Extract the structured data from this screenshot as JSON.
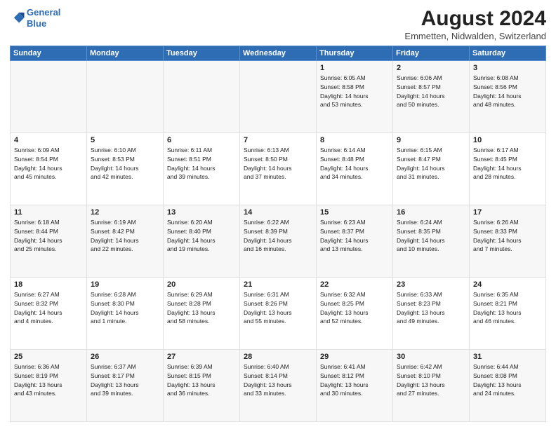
{
  "header": {
    "logo_line1": "General",
    "logo_line2": "Blue",
    "title": "August 2024",
    "subtitle": "Emmetten, Nidwalden, Switzerland"
  },
  "weekdays": [
    "Sunday",
    "Monday",
    "Tuesday",
    "Wednesday",
    "Thursday",
    "Friday",
    "Saturday"
  ],
  "weeks": [
    [
      {
        "day": "",
        "info": ""
      },
      {
        "day": "",
        "info": ""
      },
      {
        "day": "",
        "info": ""
      },
      {
        "day": "",
        "info": ""
      },
      {
        "day": "1",
        "info": "Sunrise: 6:05 AM\nSunset: 8:58 PM\nDaylight: 14 hours\nand 53 minutes."
      },
      {
        "day": "2",
        "info": "Sunrise: 6:06 AM\nSunset: 8:57 PM\nDaylight: 14 hours\nand 50 minutes."
      },
      {
        "day": "3",
        "info": "Sunrise: 6:08 AM\nSunset: 8:56 PM\nDaylight: 14 hours\nand 48 minutes."
      }
    ],
    [
      {
        "day": "4",
        "info": "Sunrise: 6:09 AM\nSunset: 8:54 PM\nDaylight: 14 hours\nand 45 minutes."
      },
      {
        "day": "5",
        "info": "Sunrise: 6:10 AM\nSunset: 8:53 PM\nDaylight: 14 hours\nand 42 minutes."
      },
      {
        "day": "6",
        "info": "Sunrise: 6:11 AM\nSunset: 8:51 PM\nDaylight: 14 hours\nand 39 minutes."
      },
      {
        "day": "7",
        "info": "Sunrise: 6:13 AM\nSunset: 8:50 PM\nDaylight: 14 hours\nand 37 minutes."
      },
      {
        "day": "8",
        "info": "Sunrise: 6:14 AM\nSunset: 8:48 PM\nDaylight: 14 hours\nand 34 minutes."
      },
      {
        "day": "9",
        "info": "Sunrise: 6:15 AM\nSunset: 8:47 PM\nDaylight: 14 hours\nand 31 minutes."
      },
      {
        "day": "10",
        "info": "Sunrise: 6:17 AM\nSunset: 8:45 PM\nDaylight: 14 hours\nand 28 minutes."
      }
    ],
    [
      {
        "day": "11",
        "info": "Sunrise: 6:18 AM\nSunset: 8:44 PM\nDaylight: 14 hours\nand 25 minutes."
      },
      {
        "day": "12",
        "info": "Sunrise: 6:19 AM\nSunset: 8:42 PM\nDaylight: 14 hours\nand 22 minutes."
      },
      {
        "day": "13",
        "info": "Sunrise: 6:20 AM\nSunset: 8:40 PM\nDaylight: 14 hours\nand 19 minutes."
      },
      {
        "day": "14",
        "info": "Sunrise: 6:22 AM\nSunset: 8:39 PM\nDaylight: 14 hours\nand 16 minutes."
      },
      {
        "day": "15",
        "info": "Sunrise: 6:23 AM\nSunset: 8:37 PM\nDaylight: 14 hours\nand 13 minutes."
      },
      {
        "day": "16",
        "info": "Sunrise: 6:24 AM\nSunset: 8:35 PM\nDaylight: 14 hours\nand 10 minutes."
      },
      {
        "day": "17",
        "info": "Sunrise: 6:26 AM\nSunset: 8:33 PM\nDaylight: 14 hours\nand 7 minutes."
      }
    ],
    [
      {
        "day": "18",
        "info": "Sunrise: 6:27 AM\nSunset: 8:32 PM\nDaylight: 14 hours\nand 4 minutes."
      },
      {
        "day": "19",
        "info": "Sunrise: 6:28 AM\nSunset: 8:30 PM\nDaylight: 14 hours\nand 1 minute."
      },
      {
        "day": "20",
        "info": "Sunrise: 6:29 AM\nSunset: 8:28 PM\nDaylight: 13 hours\nand 58 minutes."
      },
      {
        "day": "21",
        "info": "Sunrise: 6:31 AM\nSunset: 8:26 PM\nDaylight: 13 hours\nand 55 minutes."
      },
      {
        "day": "22",
        "info": "Sunrise: 6:32 AM\nSunset: 8:25 PM\nDaylight: 13 hours\nand 52 minutes."
      },
      {
        "day": "23",
        "info": "Sunrise: 6:33 AM\nSunset: 8:23 PM\nDaylight: 13 hours\nand 49 minutes."
      },
      {
        "day": "24",
        "info": "Sunrise: 6:35 AM\nSunset: 8:21 PM\nDaylight: 13 hours\nand 46 minutes."
      }
    ],
    [
      {
        "day": "25",
        "info": "Sunrise: 6:36 AM\nSunset: 8:19 PM\nDaylight: 13 hours\nand 43 minutes."
      },
      {
        "day": "26",
        "info": "Sunrise: 6:37 AM\nSunset: 8:17 PM\nDaylight: 13 hours\nand 39 minutes."
      },
      {
        "day": "27",
        "info": "Sunrise: 6:39 AM\nSunset: 8:15 PM\nDaylight: 13 hours\nand 36 minutes."
      },
      {
        "day": "28",
        "info": "Sunrise: 6:40 AM\nSunset: 8:14 PM\nDaylight: 13 hours\nand 33 minutes."
      },
      {
        "day": "29",
        "info": "Sunrise: 6:41 AM\nSunset: 8:12 PM\nDaylight: 13 hours\nand 30 minutes."
      },
      {
        "day": "30",
        "info": "Sunrise: 6:42 AM\nSunset: 8:10 PM\nDaylight: 13 hours\nand 27 minutes."
      },
      {
        "day": "31",
        "info": "Sunrise: 6:44 AM\nSunset: 8:08 PM\nDaylight: 13 hours\nand 24 minutes."
      }
    ]
  ]
}
